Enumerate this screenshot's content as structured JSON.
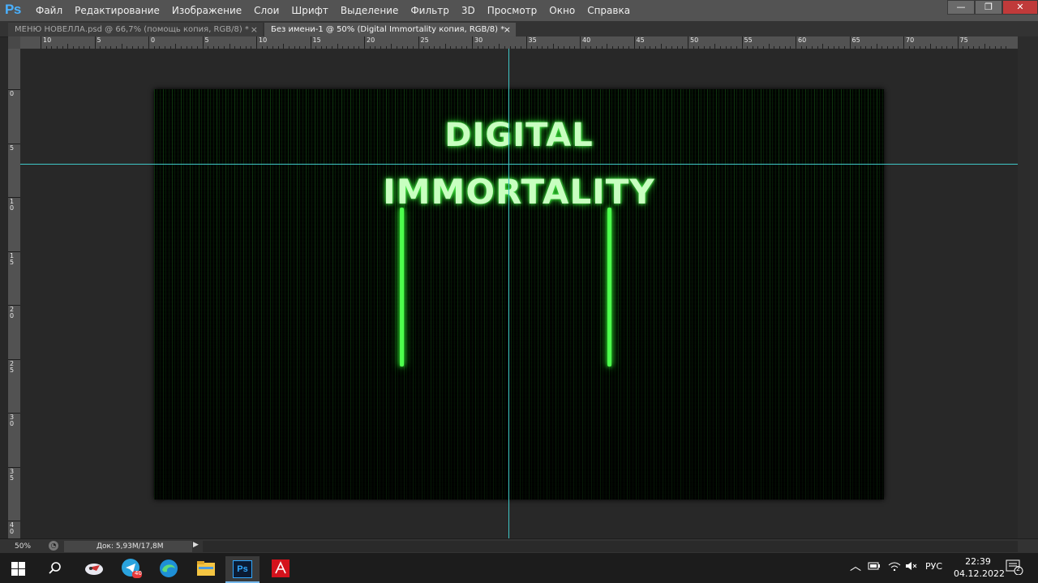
{
  "app": {
    "logo": "Ps"
  },
  "menu": [
    "Файл",
    "Редактирование",
    "Изображение",
    "Слои",
    "Шрифт",
    "Выделение",
    "Фильтр",
    "3D",
    "Просмотр",
    "Окно",
    "Справка"
  ],
  "window_controls": {
    "minimize": "—",
    "restore": "❐",
    "close": "✕"
  },
  "tabs": [
    {
      "label": "МЕНЮ НОВЕЛЛА.psd @ 66,7% (помощь копия, RGB/8) *",
      "close": "×"
    },
    {
      "label": "Без имени-1 @ 50% (Digital Immortality копия, RGB/8) *",
      "close": "×"
    }
  ],
  "ruler": {
    "h_labels": [
      "10",
      "5",
      "0",
      "5",
      "10",
      "15",
      "20",
      "25",
      "30",
      "35",
      "40",
      "45",
      "50",
      "55",
      "60",
      "65",
      "70",
      "75"
    ],
    "v_labels": [
      "0",
      "5",
      "10",
      "15",
      "20",
      "25",
      "30",
      "35",
      "40"
    ]
  },
  "canvas": {
    "line1": "DIGITAL",
    "line2": "IMMORTALITY",
    "glow_color": "#4dff4d",
    "guide_color": "#3fc7c7"
  },
  "status": {
    "zoom": "50%",
    "doc": "Док: 5,93М/17,8М",
    "arrow": "▶"
  },
  "taskbar": {
    "icons": [
      "windows-start-icon",
      "search-icon",
      "app-bird-icon",
      "telegram-icon",
      "edge-icon",
      "file-explorer-icon",
      "photoshop-icon",
      "acrobat-icon"
    ],
    "telegram_badge": "40",
    "ps_label": "Ps",
    "tray_arrow": "︿",
    "lang": "РУС",
    "time": "22:39",
    "date": "04.12.2022",
    "notifications": "2"
  }
}
